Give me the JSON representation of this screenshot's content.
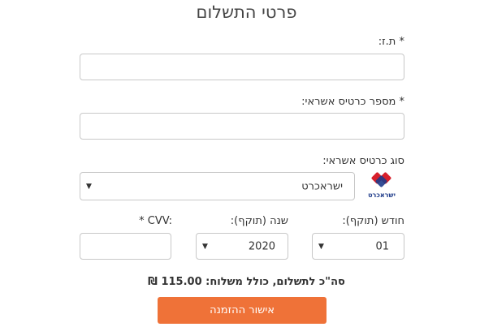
{
  "form": {
    "title": "פרטי התשלום",
    "id_label": "* ת.ז:",
    "card_number_label": "* מספר כרטיס אשראי:",
    "card_type_label": "סוג כרטיס אשראי:",
    "card_type_value": "ישראכרט",
    "card_logo_text": "ישראכרט",
    "month_label": "חודש (תוקף):",
    "month_value": "01",
    "year_label": "שנה (תוקף):",
    "year_value": "2020",
    "cvv_label": "* CVV:",
    "total_text": "סה\"כ לתשלום, כולל משלוח: 115.00 ₪",
    "submit_label": "אישור ההזמנה"
  },
  "colors": {
    "accent": "#ef7238",
    "logo_red": "#d71f2b",
    "logo_blue": "#1e3b8a"
  },
  "icons": {
    "dropdown": "triangle-down",
    "card_logo": "isracard-logo"
  }
}
